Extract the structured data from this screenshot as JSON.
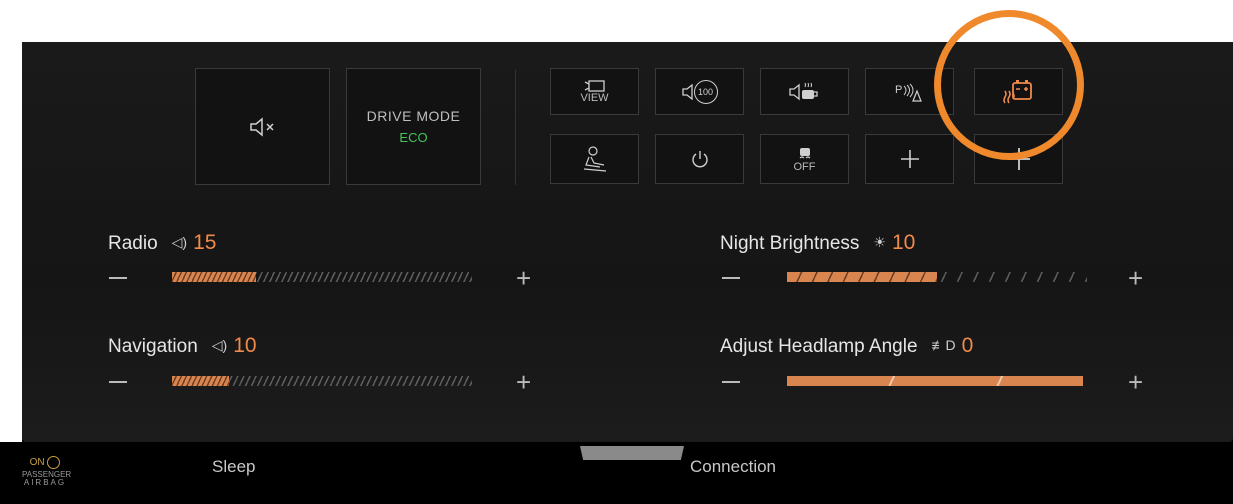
{
  "quick_controls": {
    "mute_icon": "speaker-mute-icon",
    "drive_mode": {
      "title": "DRIVE MODE",
      "value": "ECO"
    },
    "view": "VIEW",
    "speed_limit": "100",
    "esc_off": "OFF"
  },
  "sliders": {
    "radio": {
      "label": "Radio",
      "value": "15",
      "level": 0.28
    },
    "navigation": {
      "label": "Navigation",
      "value": "10",
      "level": 0.19
    },
    "night_brightness": {
      "label": "Night Brightness",
      "value": "10",
      "level": 0.5
    },
    "headlamp": {
      "label": "Adjust Headlamp Angle",
      "value": "0",
      "level": 1.0
    }
  },
  "bottom_bar": {
    "left": "Sleep",
    "right": "Connection",
    "airbag_on": "ON",
    "airbag_line1": "PASSENGER",
    "airbag_line2": "AIRBAG"
  },
  "colors": {
    "accent": "#ef8a4a",
    "eco": "#47c25a",
    "highlight_ring": "#f0892b"
  }
}
